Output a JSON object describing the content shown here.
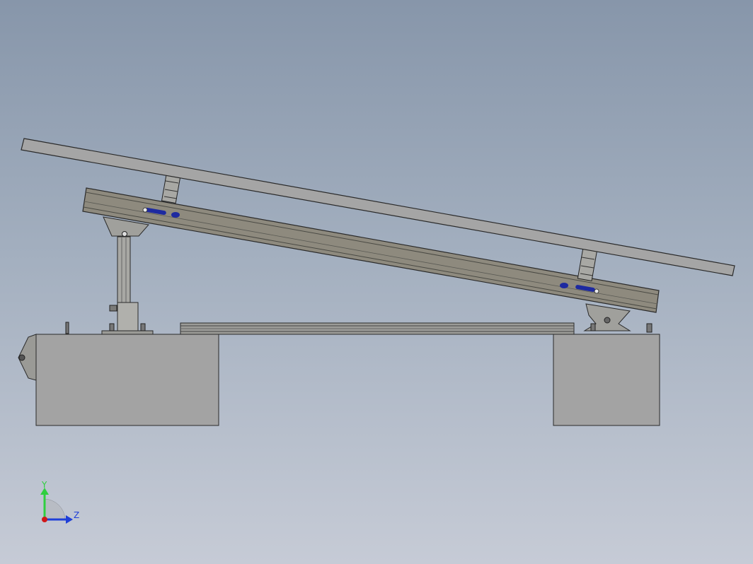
{
  "view": {
    "type": "cad-model-side-view",
    "background_top": "#8796aa",
    "background_bottom": "#c6cbd6"
  },
  "triad": {
    "y_label": "Y",
    "z_label": "Z",
    "y_color": "#2fcf3f",
    "z_color": "#1f3fd8",
    "x_color": "#d01818"
  },
  "colors": {
    "concrete": "#a3a3a3",
    "beam": "#8e8a7e",
    "panel": "#a5a5a5",
    "outline": "#2a2a2a",
    "bolt_blue": "#1e2aa0"
  }
}
